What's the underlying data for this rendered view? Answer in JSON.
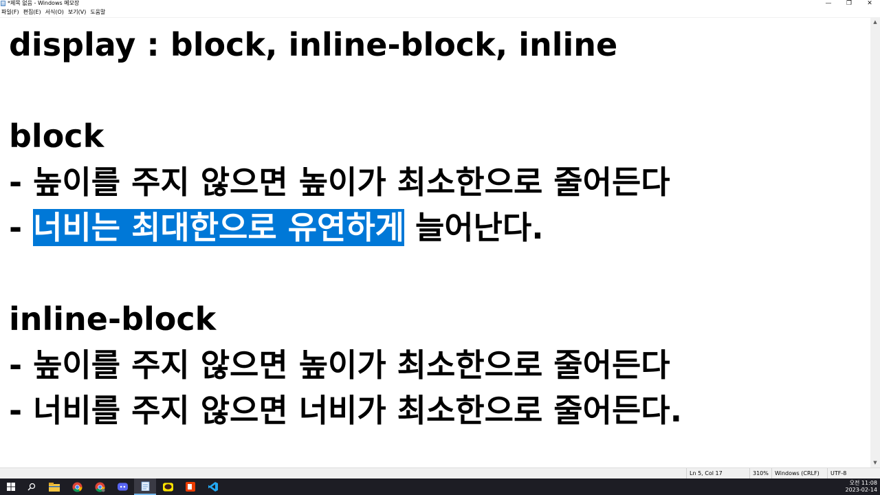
{
  "window": {
    "title": "*제목 없음 - Windows 메모장",
    "minimize_glyph": "—",
    "maximize_glyph": "❐",
    "close_glyph": "✕"
  },
  "menu": {
    "items": [
      {
        "label": "파일(F)"
      },
      {
        "label": "편집(E)"
      },
      {
        "label": "서식(O)"
      },
      {
        "label": "보기(V)"
      },
      {
        "label": "도움말"
      }
    ]
  },
  "editor": {
    "line1": "display : block, inline-block, inline",
    "line3": "block",
    "line4": "- 높이를 주지 않으면 높이가 최소한으로 줄어든다",
    "line5_prefix": "- ",
    "line5_selected": "너비는 최대한으로 유연하게",
    "line5_suffix": " 늘어난다.",
    "line7": "inline-block",
    "line8": "- 높이를 주지 않으면 높이가 최소한으로 줄어든다",
    "line9": "- 너비를 주지 않으면 너비가 최소한으로 줄어든다.",
    "selection_color": "#0078d7"
  },
  "status": {
    "position": "Ln 5, Col 17",
    "zoom": "310%",
    "line_ending": "Windows (CRLF)",
    "encoding": "UTF-8"
  },
  "taskbar": {
    "apps": [
      {
        "icon": "start-windows-icon"
      },
      {
        "icon": "search-icon"
      },
      {
        "icon": "file-explorer-icon"
      },
      {
        "icon": "chrome-icon"
      },
      {
        "icon": "chrome-alt-icon"
      },
      {
        "icon": "discord-icon"
      },
      {
        "icon": "notepad-icon"
      },
      {
        "icon": "kakaotalk-icon"
      },
      {
        "icon": "office-icon"
      },
      {
        "icon": "vscode-icon"
      }
    ],
    "clock_time": "오전 11:08",
    "clock_date": "2023-02-14"
  }
}
